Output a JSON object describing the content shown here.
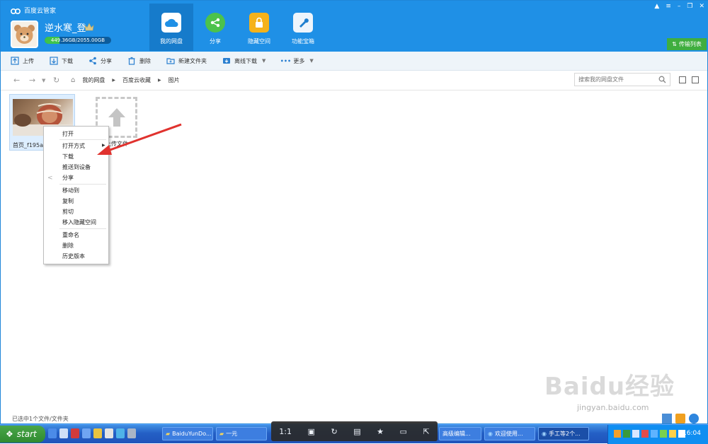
{
  "app": {
    "title": "百度云管家"
  },
  "user": {
    "name": "逆水寒_登",
    "quota_text": "449.36GB/2055.00GB",
    "quota_fraction": 0.219
  },
  "nav": {
    "tabs": [
      {
        "label": "我的网盘",
        "icon": "cloud-disk-icon",
        "active": true
      },
      {
        "label": "分享",
        "icon": "share-icon"
      },
      {
        "label": "隐藏空间",
        "icon": "lock-icon"
      },
      {
        "label": "功能宝箱",
        "icon": "toolbox-icon"
      }
    ]
  },
  "transfer_label": "传输列表",
  "toolbar": {
    "upload": "上传",
    "download": "下载",
    "share": "分享",
    "delete": "删除",
    "new_folder": "新建文件夹",
    "offline_download": "离线下载",
    "more": "更多"
  },
  "breadcrumb": [
    "我的网盘",
    "百度云收藏",
    "图片"
  ],
  "search": {
    "placeholder": "搜索我的网盘文件"
  },
  "files": [
    {
      "name": "首页_f195a"
    }
  ],
  "upload_tile_label": "上传文件",
  "context_menu": {
    "open": "打开",
    "open_with": "打开方式",
    "download": "下载",
    "push_to_device": "推送到设备",
    "share": "分享",
    "move_to": "移动到",
    "copy": "复制",
    "cut": "剪切",
    "move_to_hidden": "移入隐藏空间",
    "rename": "重命名",
    "delete": "删除",
    "history": "历史版本"
  },
  "status": {
    "selection": "已选中1个文件/文件夹"
  },
  "watermark": {
    "brand": "Baidu经验",
    "url": "jingyan.baidu.com"
  },
  "taskbar": {
    "start": "start",
    "buttons": [
      "BaiduYunDo...",
      "一元",
      "Ba...",
      "",
      "M...",
      "高级编辑...",
      "欢迎使用...",
      "手工等2个..."
    ],
    "clock": "16:04"
  },
  "viewer": {
    "zoom_label": "1:1"
  },
  "colors": {
    "header_blue": "#1f90e6",
    "active_tab": "#167bcb",
    "transfer_green": "#3fae3f",
    "arrow_red": "#e0322e",
    "taskbar_blue": "#245fc5"
  }
}
